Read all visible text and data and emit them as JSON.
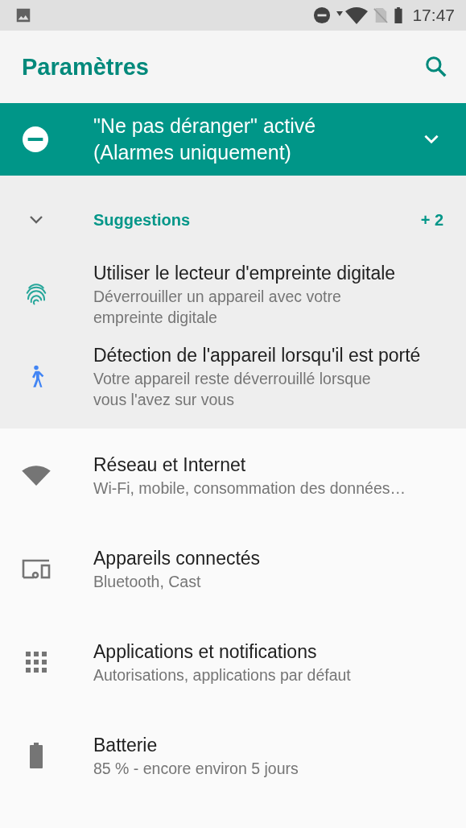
{
  "status_bar": {
    "time": "17:47"
  },
  "app_bar": {
    "title": "Paramètres"
  },
  "banner": {
    "title": "\"Ne pas déranger\" activé",
    "subtitle": "(Alarmes uniquement)",
    "expanded": false
  },
  "suggestions": {
    "label": "Suggestions",
    "count": "+ 2",
    "expanded": true,
    "items": [
      {
        "title": "Utiliser le lecteur d'empreinte digitale",
        "subtitle": "Déverrouiller un appareil avec votre empreinte digitale"
      },
      {
        "title": "Détection de l'appareil lorsqu'il est porté",
        "subtitle": "Votre appareil reste déverrouillé lorsque vous l'avez sur vous"
      }
    ]
  },
  "settings": [
    {
      "title": "Réseau et Internet",
      "subtitle": "Wi-Fi, mobile, consommation des données…"
    },
    {
      "title": "Appareils connectés",
      "subtitle": "Bluetooth, Cast"
    },
    {
      "title": "Applications et notifications",
      "subtitle": "Autorisations, applications par défaut"
    },
    {
      "title": "Batterie",
      "subtitle": "85 % - encore environ 5 jours"
    }
  ]
}
